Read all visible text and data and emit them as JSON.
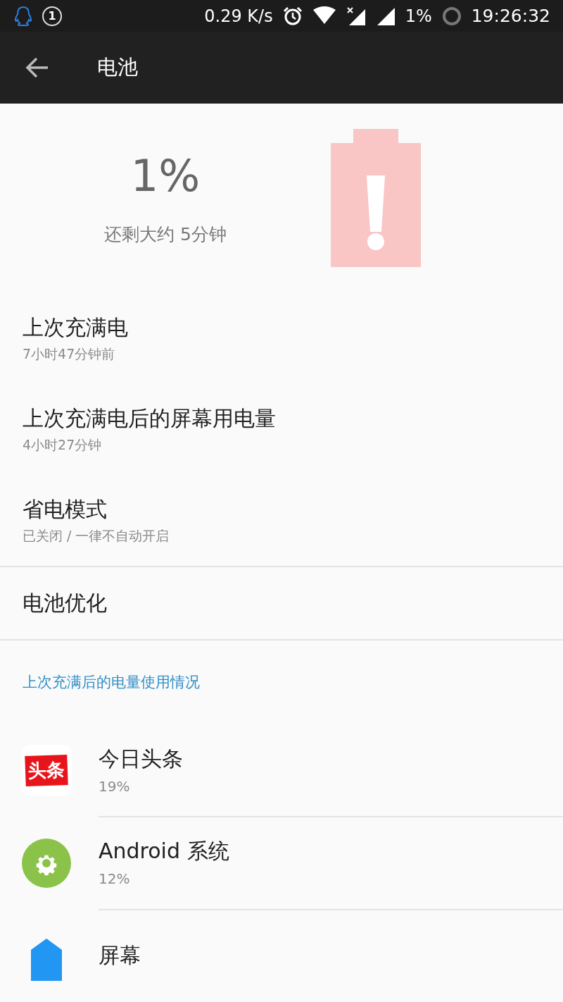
{
  "status_bar": {
    "notification_count": "1",
    "net_speed": "0.29 K/s",
    "battery": "1%",
    "time": "19:26:32"
  },
  "toolbar": {
    "title": "电池"
  },
  "battery_summary": {
    "percent": "1%",
    "remaining": "还剩大约 5分钟",
    "low": true
  },
  "settings": [
    {
      "title": "上次充满电",
      "subtitle": "7小时47分钟前",
      "divider_after": false
    },
    {
      "title": "上次充满电后的屏幕用电量",
      "subtitle": "4小时27分钟",
      "divider_after": false
    },
    {
      "title": "省电模式",
      "subtitle": "已关闭 / 一律不自动开启",
      "divider_after": true
    },
    {
      "title": "电池优化",
      "divider_after": true
    }
  ],
  "usage_section": {
    "header": "上次充满后的电量使用情况",
    "apps": [
      {
        "name": "今日头条",
        "percent": "19%",
        "kind": "logo",
        "icon_text": "头条",
        "color": "#e8141c"
      },
      {
        "name": "Android 系统",
        "percent": "12%",
        "kind": "gear",
        "color": "#8bc34a"
      },
      {
        "name": "屏幕",
        "kind": "screen",
        "color": "#2196f3"
      }
    ]
  }
}
